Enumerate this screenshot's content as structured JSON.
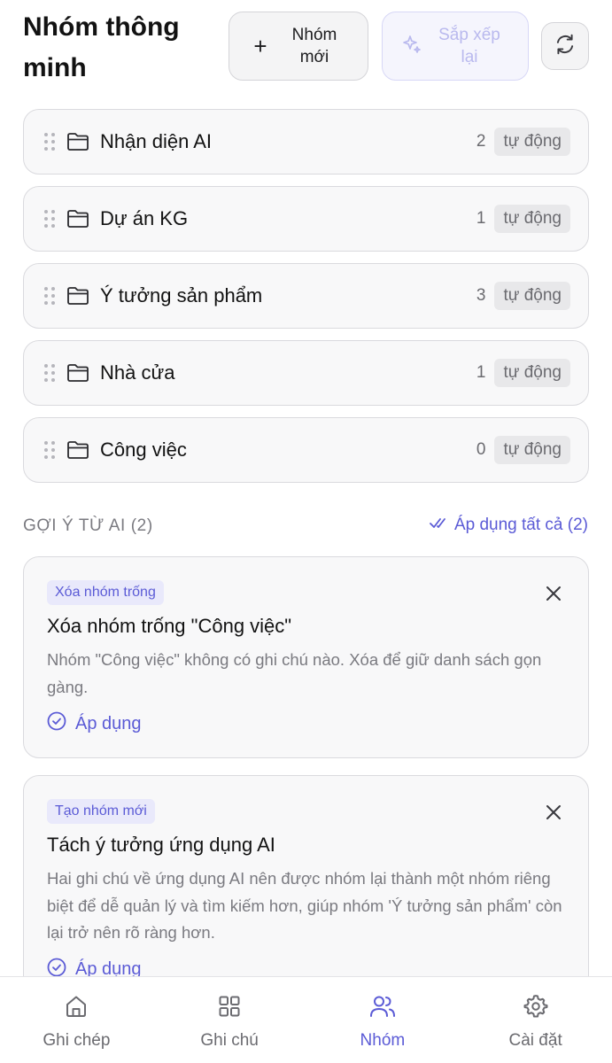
{
  "header": {
    "title": "Nhóm thông minh",
    "new_group_label": "Nhóm mới",
    "sort_label": "Sắp xếp lại"
  },
  "groups": [
    {
      "name": "Nhận diện AI",
      "count": "2",
      "badge": "tự động"
    },
    {
      "name": "Dự án KG",
      "count": "1",
      "badge": "tự động"
    },
    {
      "name": "Ý tưởng sản phẩm",
      "count": "3",
      "badge": "tự động"
    },
    {
      "name": "Nhà cửa",
      "count": "1",
      "badge": "tự động"
    },
    {
      "name": "Công việc",
      "count": "0",
      "badge": "tự động"
    }
  ],
  "suggestions": {
    "title": "GỢI Ý TỪ AI (2)",
    "apply_all_label": "Áp dụng tất cả (2)",
    "items": [
      {
        "tag": "Xóa nhóm trống",
        "title": "Xóa nhóm trống \"Công việc\"",
        "description": "Nhóm \"Công việc\" không có ghi chú nào. Xóa để giữ danh sách gọn gàng.",
        "apply_label": "Áp dụng"
      },
      {
        "tag": "Tạo nhóm mới",
        "title": "Tách ý tưởng ứng dụng AI",
        "description": "Hai ghi chú về ứng dụng AI nên được nhóm lại thành một nhóm riêng biệt để dễ quản lý và tìm kiếm hơn, giúp nhóm 'Ý tưởng sản phẩm' còn lại trở nên rõ ràng hơn.",
        "apply_label": "Áp dụng"
      }
    ]
  },
  "nav": {
    "items": [
      {
        "label": "Ghi chép",
        "icon": "home-icon"
      },
      {
        "label": "Ghi chú",
        "icon": "grid-icon"
      },
      {
        "label": "Nhóm",
        "icon": "users-icon"
      },
      {
        "label": "Cài đặt",
        "icon": "gear-icon"
      }
    ],
    "active": "Nhóm"
  },
  "colors": {
    "accent": "#5b5bd6",
    "accent_light": "#e9e9fb",
    "text_muted": "#7a7a80",
    "card_bg": "#f8f8f9",
    "border": "#dadade"
  }
}
